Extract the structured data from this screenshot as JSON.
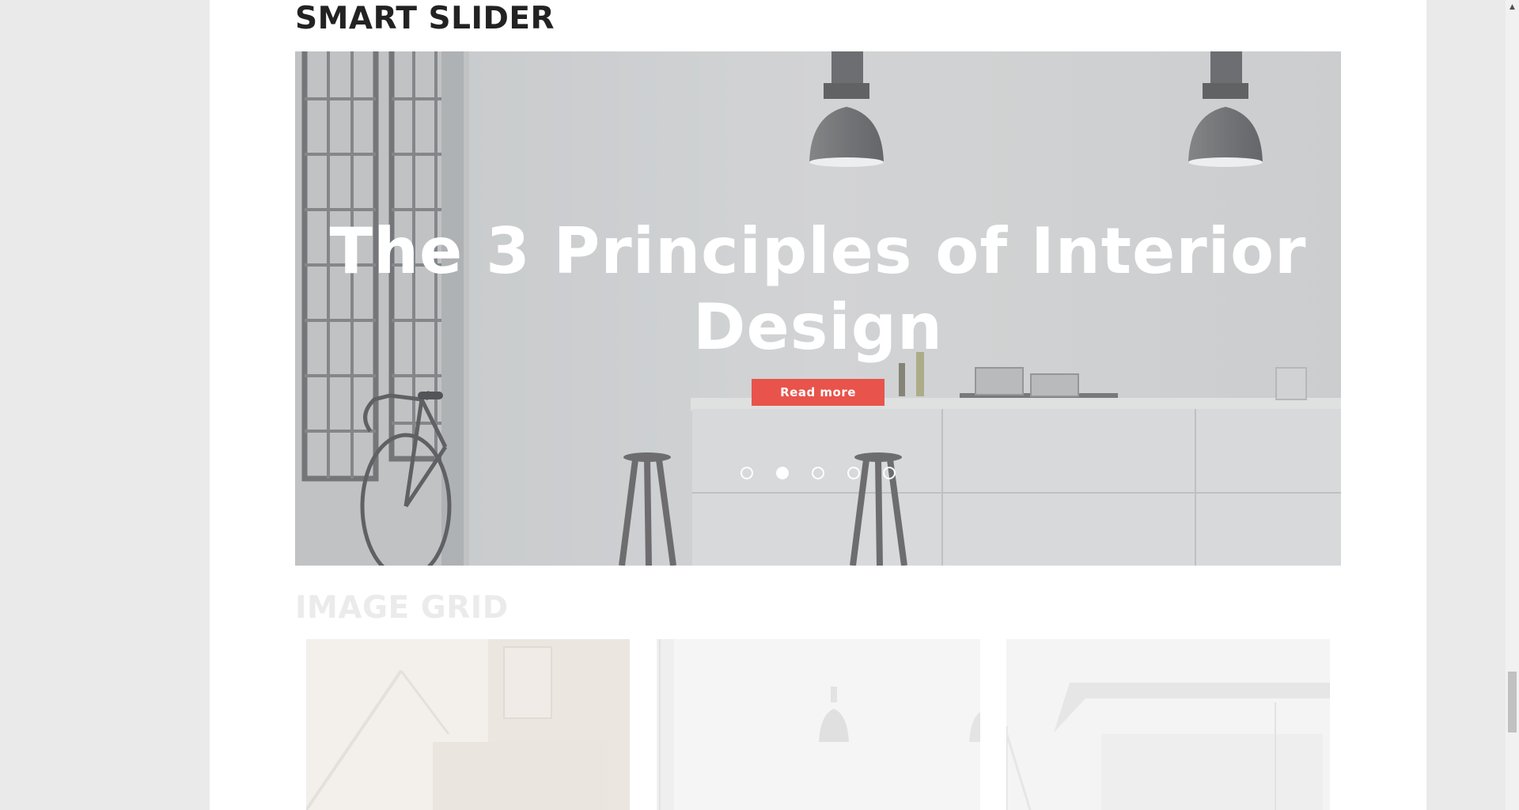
{
  "sections": {
    "smart_slider_title": "SMART SLIDER",
    "image_grid_title": "IMAGE GRID"
  },
  "slider": {
    "heading": "The 3 Principles of Interior Design",
    "button_label": "Read more",
    "slide_count": 5,
    "active_slide": 2,
    "button_color": "#e8534c",
    "background_scene": "kitchen-interior-with-pendant-lamps-bicycle-and-stools"
  },
  "image_grid": {
    "thumbnails": [
      {
        "scene": "living-room-with-desk-lamp"
      },
      {
        "scene": "white-room-with-pendant-lamps"
      },
      {
        "scene": "bright-kitchen-interior"
      }
    ]
  },
  "scrollbar": {
    "up_arrow_icon": "up-arrow-icon"
  }
}
